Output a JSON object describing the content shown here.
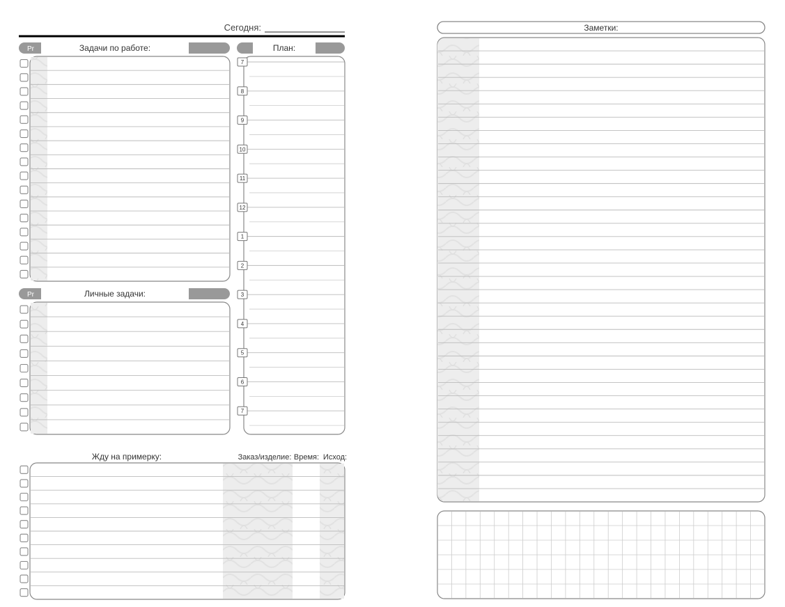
{
  "left": {
    "today_label": "Сегодня:",
    "work": {
      "pr": "Pr",
      "title": "Задачи по работе:",
      "rows": 16
    },
    "personal": {
      "pr": "Pr",
      "title": "Личные задачи:",
      "rows": 9
    },
    "plan": {
      "title": "План:",
      "hours": [
        "7",
        "8",
        "9",
        "10",
        "11",
        "12",
        "1",
        "2",
        "3",
        "4",
        "5",
        "6",
        "7"
      ]
    },
    "fitting": {
      "title": "Жду на примерку:",
      "col_order": "Заказ/изделие:",
      "col_time": "Время:",
      "col_result": "Исход:",
      "rows": 10
    }
  },
  "right": {
    "notes_title": "Заметки:",
    "notes_rows": 35,
    "grid_cols": 23,
    "grid_rows": 6
  }
}
